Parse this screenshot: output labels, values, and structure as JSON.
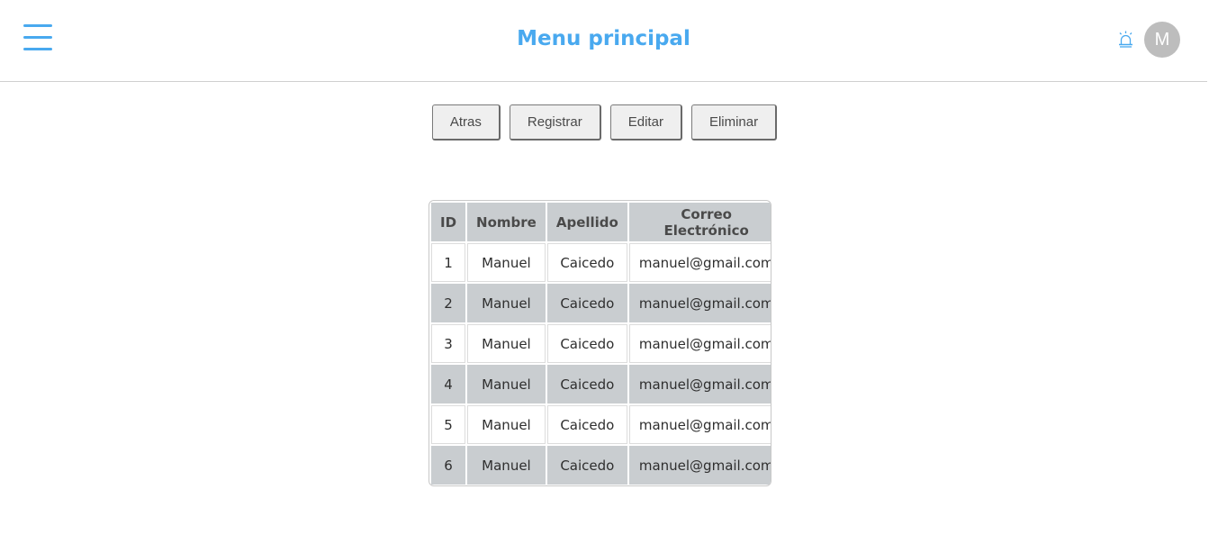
{
  "header": {
    "title": "Menu principal",
    "avatar_initial": "M",
    "icons": [
      "hamburger-menu-icon",
      "alarm-icon"
    ],
    "accent_color": "#49a9ef"
  },
  "toolbar": {
    "back_label": "Atras",
    "register_label": "Registrar",
    "edit_label": "Editar",
    "delete_label": "Eliminar"
  },
  "table": {
    "columns": [
      "ID",
      "Nombre",
      "Apellido",
      "Correo Electrónico"
    ],
    "rows": [
      [
        "1",
        "Manuel",
        "Caicedo",
        "manuel@gmail.com"
      ],
      [
        "2",
        "Manuel",
        "Caicedo",
        "manuel@gmail.com"
      ],
      [
        "3",
        "Manuel",
        "Caicedo",
        "manuel@gmail.com"
      ],
      [
        "4",
        "Manuel",
        "Caicedo",
        "manuel@gmail.com"
      ],
      [
        "5",
        "Manuel",
        "Caicedo",
        "manuel@gmail.com"
      ],
      [
        "6",
        "Manuel",
        "Caicedo",
        "manuel@gmail.com"
      ]
    ]
  }
}
